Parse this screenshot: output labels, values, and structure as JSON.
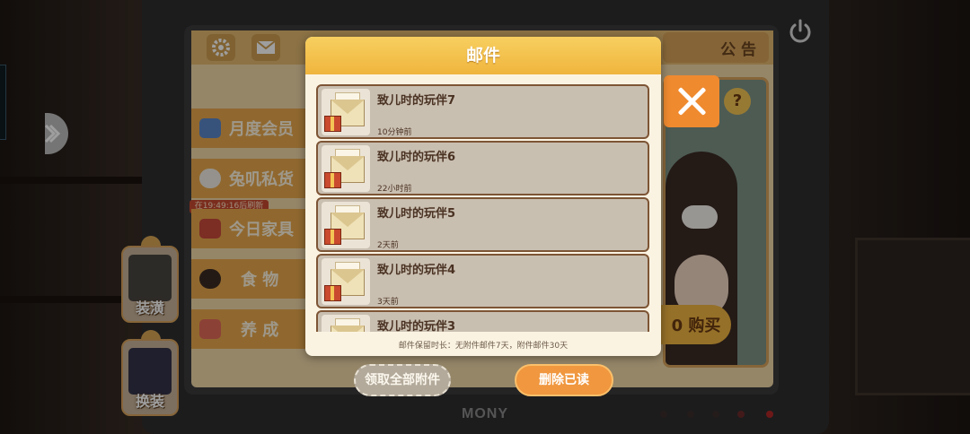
{
  "colors": {
    "header_gold": "#f0b53d",
    "dialog_bg": "#fbf3e2",
    "mail_item_bg": "#c9bfb1",
    "mail_item_border": "#7d5535",
    "close_orange": "#ef8a2f",
    "delete_orange": "#f0973f",
    "claim_grey": "#b3aa9b"
  },
  "monitor": {
    "brand": "MONY"
  },
  "background_ui": {
    "notice_tab": "公 告",
    "menu": [
      {
        "label": "月度会员",
        "icon": "vip-card-icon"
      },
      {
        "label": "兔叽私货",
        "icon": "bunny-icon"
      },
      {
        "label": "今日家具",
        "icon": "furniture-icon"
      },
      {
        "label": "食 物",
        "icon": "bowl-icon"
      },
      {
        "label": "养 成",
        "icon": "paint-icon"
      }
    ],
    "refresh_timer": "在19:49:16后刷新",
    "help": "?",
    "buy_label": "0 购买",
    "side_buttons": {
      "decorate": "装潢",
      "outfit": "换装"
    }
  },
  "mail_dialog": {
    "title": "邮件",
    "items": [
      {
        "title": "致儿时的玩伴7",
        "time": "10分钟前"
      },
      {
        "title": "致儿时的玩伴6",
        "time": "22小时前"
      },
      {
        "title": "致儿时的玩伴5",
        "time": "2天前"
      },
      {
        "title": "致儿时的玩伴4",
        "time": "3天前"
      },
      {
        "title": "致儿时的玩伴3",
        "time": ""
      }
    ],
    "footer_note": "邮件保留时长：无附件邮件7天，附件邮件30天",
    "claim_all_label": "领取全部附件",
    "delete_read_label": "删除已读"
  }
}
